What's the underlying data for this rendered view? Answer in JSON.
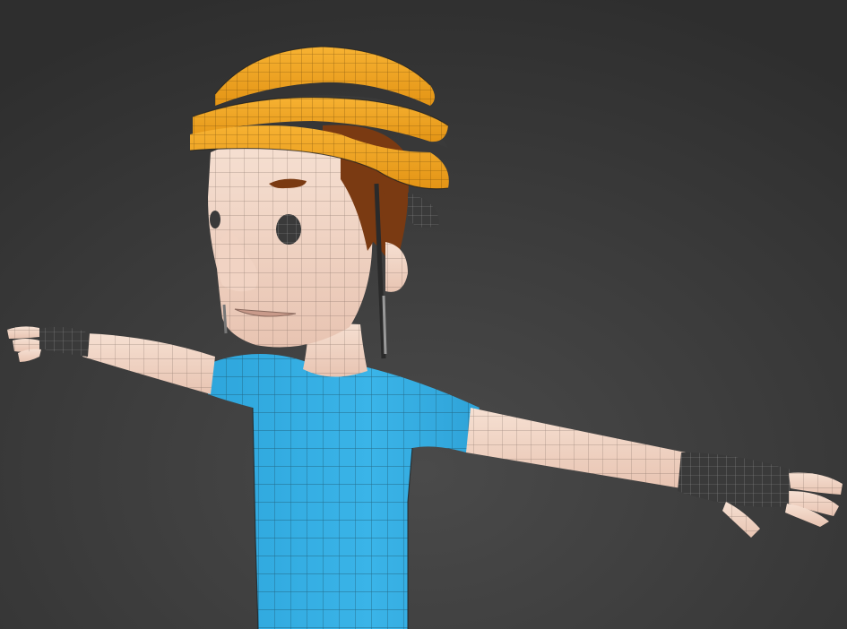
{
  "viewport": {
    "type": "perspective-3d-viewport",
    "shading_mode": "shaded-with-wireframe-overlay",
    "background_colors": {
      "top": "#2e2e2e",
      "bottom": "#4a4a4a"
    }
  },
  "model": {
    "pose": "T-pose",
    "parts": [
      {
        "name": "helmet",
        "color": "#f0a020"
      },
      {
        "name": "helmet-inner-shell",
        "color": "#3a3a3a"
      },
      {
        "name": "hair",
        "color": "#7a3a12"
      },
      {
        "name": "skin",
        "color": "#f2d7c8"
      },
      {
        "name": "eye",
        "color": "#3a3a3a"
      },
      {
        "name": "eyebrow",
        "color": "#7a3a12"
      },
      {
        "name": "shirt",
        "color": "#3ab4e8"
      },
      {
        "name": "glove",
        "color": "#3a3a3a"
      }
    ]
  },
  "icons": {
    "viewport": "3d-viewport",
    "model": "character-mesh-icon"
  }
}
